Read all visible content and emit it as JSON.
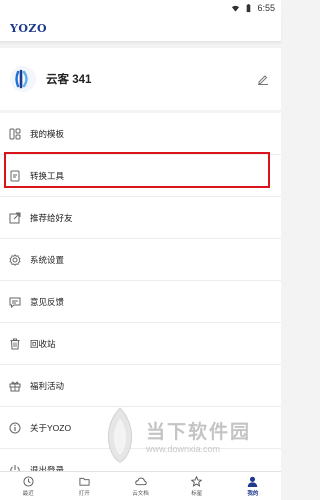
{
  "status_bar": {
    "time": "6:55"
  },
  "app": {
    "logo": "YOZO"
  },
  "profile": {
    "username": "云客 341"
  },
  "menu": {
    "items": [
      {
        "label": "我的模板",
        "icon": "template-icon"
      },
      {
        "label": "转换工具",
        "icon": "convert-tool-icon"
      },
      {
        "label": "推荐给好友",
        "icon": "share-icon"
      },
      {
        "label": "系统设置",
        "icon": "gear-icon"
      },
      {
        "label": "意见反馈",
        "icon": "feedback-icon"
      },
      {
        "label": "回收站",
        "icon": "trash-icon"
      },
      {
        "label": "福利活动",
        "icon": "gift-icon"
      },
      {
        "label": "关于YOZO",
        "icon": "info-icon"
      },
      {
        "label": "退出登录",
        "icon": "power-icon"
      }
    ],
    "highlighted_item": "转换工具"
  },
  "bottom_nav": {
    "items": [
      {
        "label": "最近",
        "icon": "clock-icon",
        "active": false
      },
      {
        "label": "打开",
        "icon": "folder-icon",
        "active": false
      },
      {
        "label": "云文档",
        "icon": "cloud-icon",
        "active": false
      },
      {
        "label": "标星",
        "icon": "star-icon",
        "active": false
      },
      {
        "label": "我的",
        "icon": "user-icon",
        "active": true
      }
    ]
  },
  "colors": {
    "brand": "#1e3a8a",
    "highlight_border": "#d9141a"
  },
  "watermark": {
    "title": "当下软件园",
    "url": "www.downxia.com"
  }
}
